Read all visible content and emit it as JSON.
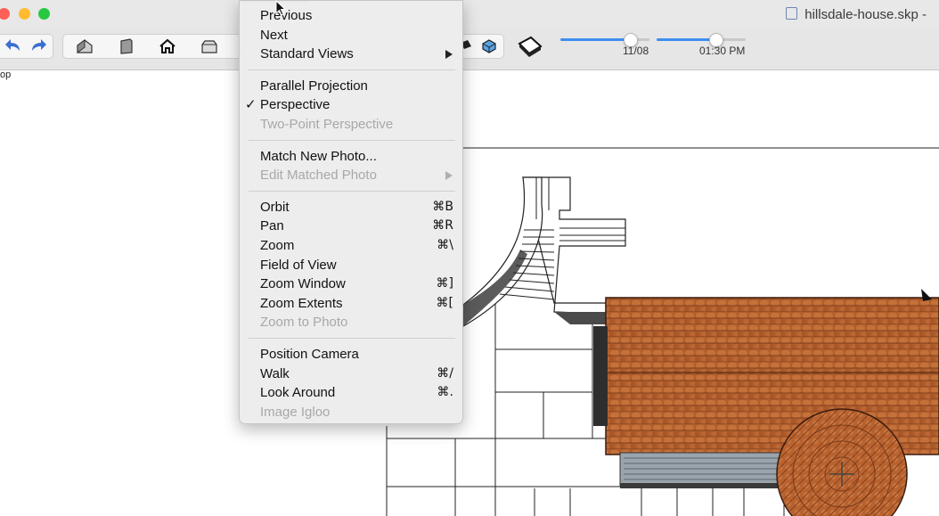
{
  "window": {
    "title": "hillsdale-house.skp -",
    "traffic_lights": [
      {
        "name": "close",
        "color": "#fe5f57"
      },
      {
        "name": "minimize",
        "color": "#febc2e"
      },
      {
        "name": "zoom",
        "color": "#28c840"
      }
    ]
  },
  "toolbar": {
    "buttons": [
      {
        "name": "undo-icon"
      },
      {
        "name": "redo-icon"
      },
      {
        "name": "iso-view-icon"
      },
      {
        "name": "front-view-icon"
      },
      {
        "name": "home-view-icon"
      },
      {
        "name": "top-view-icon"
      },
      {
        "name": "shadow-toggle-icon"
      },
      {
        "name": "fog-toggle-icon"
      },
      {
        "name": "section-plane-icon"
      }
    ],
    "shadow_date": "11/08",
    "shadow_time": "01:30 PM",
    "date_slider_level": 0.78,
    "time_slider_level": 0.66,
    "accent": "#3d8ef0"
  },
  "outliner_fragment": "op",
  "view_menu": {
    "items": [
      {
        "label": "Previous"
      },
      {
        "label": "Next"
      },
      {
        "label": "Standard Views",
        "submenu": true
      },
      {
        "sep": true
      },
      {
        "label": "Parallel Projection"
      },
      {
        "label": "Perspective",
        "checked": true
      },
      {
        "label": "Two-Point Perspective",
        "disabled": true
      },
      {
        "sep": true
      },
      {
        "label": "Match New Photo..."
      },
      {
        "label": "Edit Matched Photo",
        "disabled": true,
        "submenu": true
      },
      {
        "sep": true
      },
      {
        "label": "Orbit",
        "shortcut": "⌘B"
      },
      {
        "label": "Pan",
        "shortcut": "⌘R"
      },
      {
        "label": "Zoom",
        "shortcut": "⌘\\"
      },
      {
        "label": "Field of View"
      },
      {
        "label": "Zoom Window",
        "shortcut": "⌘]"
      },
      {
        "label": "Zoom Extents",
        "shortcut": "⌘["
      },
      {
        "label": "Zoom to Photo",
        "disabled": true
      },
      {
        "sep": true
      },
      {
        "label": "Position Camera"
      },
      {
        "label": "Walk",
        "shortcut": "⌘/"
      },
      {
        "label": "Look Around",
        "shortcut": "⌘."
      },
      {
        "label": "Image Igloo",
        "disabled": true
      }
    ],
    "checkmark": "✓"
  },
  "colors": {
    "roof": "#b4622f",
    "roof_dark": "#8a4522",
    "gutter": "#5e5e5e",
    "glass": "#9aa4ad"
  }
}
